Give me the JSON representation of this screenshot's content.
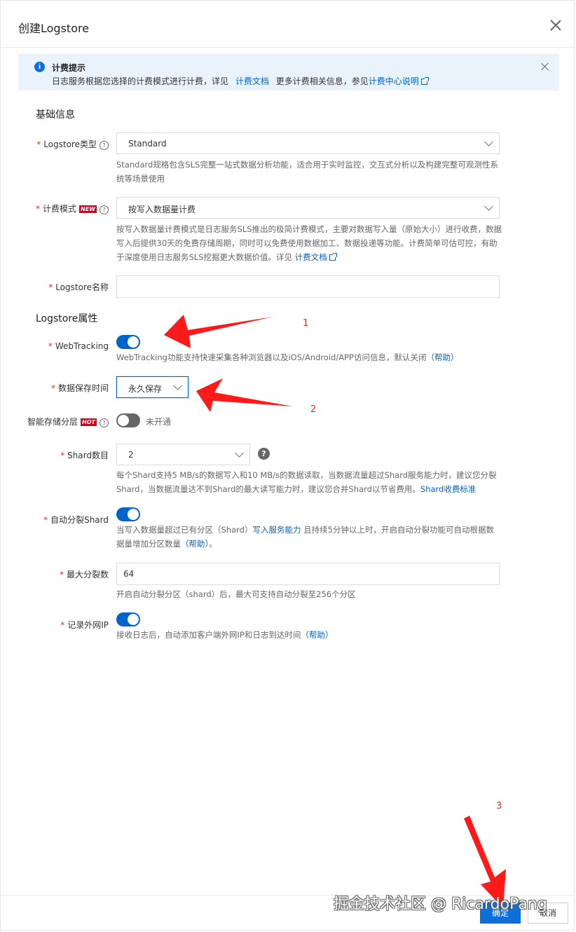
{
  "dialog": {
    "title": "创建Logstore"
  },
  "notice": {
    "title": "计费提示",
    "text_prefix": "日志服务根据您选择的计费模式进行计费，详见",
    "link1": "计费文档",
    "text_mid": "更多计费相关信息，参见",
    "link2": "计费中心说明"
  },
  "basic": {
    "section_title": "基础信息",
    "logstore_type": {
      "label": "Logstore类型",
      "value": "Standard",
      "help": "Standard规格包含SLS完整一站式数据分析功能，适合用于实时监控，交互式分析以及构建完整可观测性系统等场景使用"
    },
    "billing_mode": {
      "label": "计费模式",
      "badge": "NEW",
      "value": "按写入数据量计费",
      "help": "按写入数据量计费模式是日志服务SLS推出的极简计费模式，主要对数据写入量（原始大小）进行收费，数据写入后提供30天的免费存储周期，同时可以免费使用数据加工、数据投递等功能。计费简单可估可控，有助于深度使用日志服务SLS挖掘更大数据价值。详见",
      "help_link": "计费文档"
    },
    "logstore_name": {
      "label": "Logstore名称",
      "value": ""
    }
  },
  "props": {
    "section_title": "Logstore属性",
    "webtracking": {
      "label": "WebTracking",
      "on": true,
      "help": "WebTracking功能支持快速采集各种浏览器以及iOS/Android/APP访问信息，默认关闭",
      "help_link": "（帮助）"
    },
    "retention": {
      "label": "数据保存时间",
      "value": "永久保存"
    },
    "tiered_storage": {
      "label": "智能存储分层",
      "badge": "HOT",
      "on": false,
      "status": "未开通"
    },
    "shard_count": {
      "label": "Shard数目",
      "value": "2",
      "help": "每个Shard支持5 MB/s的数据写入和10 MB/s的数据读取，当数据流量超过Shard服务能力时，建议您分裂Shard，当数据流量达不到Shard的最大读写能力时，建议您合并Shard以节省费用。",
      "help_link": "Shard收费标准"
    },
    "auto_split": {
      "label": "自动分裂Shard",
      "on": true,
      "help_prefix": "当写入数据量超过已有分区（Shard）",
      "help_link1": "写入服务能力",
      "help_suffix": "且持续5分钟以上时，开启自动分裂功能可自动根据数据量增加分区数量",
      "help_link2": "（帮助）",
      "help_end": "。"
    },
    "max_split": {
      "label": "最大分裂数",
      "value": "64",
      "help": "开启自动分裂分区（shard）后，最大可支持自动分裂至256个分区"
    },
    "record_ip": {
      "label": "记录外网IP",
      "on": true,
      "help": "接收日志后，自动添加客户端外网IP和日志到达时间",
      "help_link": "（帮助）"
    }
  },
  "footer": {
    "ok": "确定",
    "cancel": "取消"
  },
  "annotations": {
    "n1": "1",
    "n2": "2",
    "n3": "3"
  },
  "watermark": "掘金技术社区 @ RicardoPang",
  "colors": {
    "primary": "#0064c8",
    "required": "#e0302a",
    "arrow": "#ff1a1a"
  }
}
